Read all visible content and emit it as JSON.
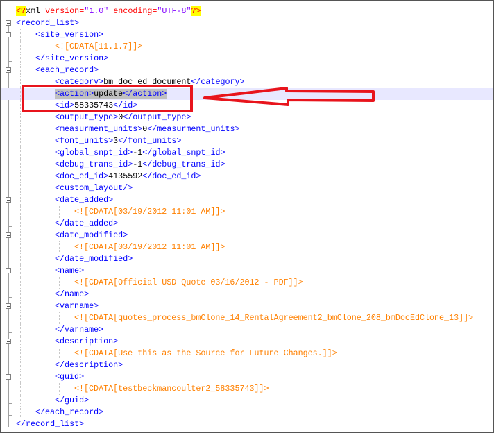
{
  "editor": {
    "current_line": 7,
    "colors": {
      "tag": "#0000ff",
      "text": "#000000",
      "cdata": "#ff8000",
      "current_line": "#e8e8ff",
      "annotation": "#e8141c"
    },
    "lines": [
      {
        "indent": 0,
        "segments": [
          {
            "k": "pi",
            "v": "<?"
          },
          {
            "k": "x",
            "v": "xml "
          },
          {
            "k": "a",
            "v": "version="
          },
          {
            "k": "s",
            "v": "\"1.0\" "
          },
          {
            "k": "a",
            "v": "encoding="
          },
          {
            "k": "s",
            "v": "\"UTF-8\""
          },
          {
            "k": "pi",
            "v": "?>"
          }
        ]
      },
      {
        "indent": 0,
        "fold": "open",
        "segments": [
          {
            "k": "t",
            "v": "<record_list>"
          }
        ]
      },
      {
        "indent": 1,
        "fold": "open",
        "segments": [
          {
            "k": "t",
            "v": "<site_version>"
          }
        ]
      },
      {
        "indent": 2,
        "segments": [
          {
            "k": "c",
            "v": "<![CDATA[11.1.7]]>"
          }
        ]
      },
      {
        "indent": 1,
        "fold": "end",
        "segments": [
          {
            "k": "t",
            "v": "</site_version>"
          }
        ]
      },
      {
        "indent": 1,
        "fold": "open",
        "segments": [
          {
            "k": "t",
            "v": "<each_record>"
          }
        ]
      },
      {
        "indent": 2,
        "segments": [
          {
            "k": "t",
            "v": "<category>"
          },
          {
            "k": "x",
            "v": "bm doc ed document"
          },
          {
            "k": "t",
            "v": "</category>"
          }
        ]
      },
      {
        "indent": 2,
        "selected": true,
        "segments": [
          {
            "k": "t",
            "v": "<action>"
          },
          {
            "k": "x",
            "v": "update"
          },
          {
            "k": "t",
            "v": "</action>"
          }
        ]
      },
      {
        "indent": 2,
        "segments": [
          {
            "k": "t",
            "v": "<id>"
          },
          {
            "k": "x",
            "v": "58335743"
          },
          {
            "k": "t",
            "v": "</id>"
          }
        ]
      },
      {
        "indent": 2,
        "segments": [
          {
            "k": "t",
            "v": "<output_type>"
          },
          {
            "k": "x",
            "v": "0"
          },
          {
            "k": "t",
            "v": "</output_type>"
          }
        ]
      },
      {
        "indent": 2,
        "segments": [
          {
            "k": "t",
            "v": "<measurment_units>"
          },
          {
            "k": "x",
            "v": "0"
          },
          {
            "k": "t",
            "v": "</measurment_units>"
          }
        ]
      },
      {
        "indent": 2,
        "segments": [
          {
            "k": "t",
            "v": "<font_units>"
          },
          {
            "k": "x",
            "v": "3"
          },
          {
            "k": "t",
            "v": "</font_units>"
          }
        ]
      },
      {
        "indent": 2,
        "segments": [
          {
            "k": "t",
            "v": "<global_snpt_id>"
          },
          {
            "k": "x",
            "v": "-1"
          },
          {
            "k": "t",
            "v": "</global_snpt_id>"
          }
        ]
      },
      {
        "indent": 2,
        "segments": [
          {
            "k": "t",
            "v": "<debug_trans_id>"
          },
          {
            "k": "x",
            "v": "-1"
          },
          {
            "k": "t",
            "v": "</debug_trans_id>"
          }
        ]
      },
      {
        "indent": 2,
        "segments": [
          {
            "k": "t",
            "v": "<doc_ed_id>"
          },
          {
            "k": "x",
            "v": "4135592"
          },
          {
            "k": "t",
            "v": "</doc_ed_id>"
          }
        ]
      },
      {
        "indent": 2,
        "segments": [
          {
            "k": "t",
            "v": "<custom_layout/>"
          }
        ]
      },
      {
        "indent": 2,
        "fold": "open",
        "segments": [
          {
            "k": "t",
            "v": "<date_added>"
          }
        ]
      },
      {
        "indent": 3,
        "segments": [
          {
            "k": "c",
            "v": "<![CDATA[03/19/2012 11:01 AM]]>"
          }
        ]
      },
      {
        "indent": 2,
        "fold": "end",
        "segments": [
          {
            "k": "t",
            "v": "</date_added>"
          }
        ]
      },
      {
        "indent": 2,
        "fold": "open",
        "segments": [
          {
            "k": "t",
            "v": "<date_modified>"
          }
        ]
      },
      {
        "indent": 3,
        "segments": [
          {
            "k": "c",
            "v": "<![CDATA[03/19/2012 11:01 AM]]>"
          }
        ]
      },
      {
        "indent": 2,
        "fold": "end",
        "segments": [
          {
            "k": "t",
            "v": "</date_modified>"
          }
        ]
      },
      {
        "indent": 2,
        "fold": "open",
        "segments": [
          {
            "k": "t",
            "v": "<name>"
          }
        ]
      },
      {
        "indent": 3,
        "segments": [
          {
            "k": "c",
            "v": "<![CDATA[Official USD Quote 03/16/2012 - PDF]]>"
          }
        ]
      },
      {
        "indent": 2,
        "fold": "end",
        "segments": [
          {
            "k": "t",
            "v": "</name>"
          }
        ]
      },
      {
        "indent": 2,
        "fold": "open",
        "segments": [
          {
            "k": "t",
            "v": "<varname>"
          }
        ]
      },
      {
        "indent": 3,
        "segments": [
          {
            "k": "c",
            "v": "<![CDATA[quotes_process_bmClone_14_RentalAgreement2_bmClone_208_bmDocEdClone_13]]>"
          }
        ]
      },
      {
        "indent": 2,
        "fold": "end",
        "segments": [
          {
            "k": "t",
            "v": "</varname>"
          }
        ]
      },
      {
        "indent": 2,
        "fold": "open",
        "segments": [
          {
            "k": "t",
            "v": "<description>"
          }
        ]
      },
      {
        "indent": 3,
        "segments": [
          {
            "k": "c",
            "v": "<![CDATA[Use this as the Source for Future Changes.]]>"
          }
        ]
      },
      {
        "indent": 2,
        "fold": "end",
        "segments": [
          {
            "k": "t",
            "v": "</description>"
          }
        ]
      },
      {
        "indent": 2,
        "fold": "open",
        "segments": [
          {
            "k": "t",
            "v": "<guid>"
          }
        ]
      },
      {
        "indent": 3,
        "segments": [
          {
            "k": "c",
            "v": "<![CDATA[testbeckmancoulter2_58335743]]>"
          }
        ]
      },
      {
        "indent": 2,
        "fold": "end",
        "segments": [
          {
            "k": "t",
            "v": "</guid>"
          }
        ]
      },
      {
        "indent": 1,
        "fold": "end",
        "segments": [
          {
            "k": "t",
            "v": "</each_record>"
          }
        ]
      },
      {
        "indent": 0,
        "fold": "end",
        "segments": [
          {
            "k": "t",
            "v": "</record_list>"
          }
        ]
      }
    ]
  }
}
